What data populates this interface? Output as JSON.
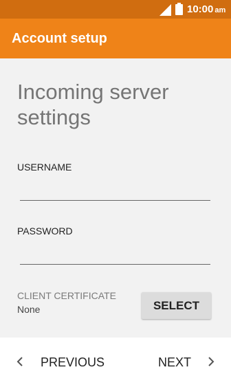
{
  "status_bar": {
    "time": "10:00",
    "period": "am",
    "icons": [
      "signal-icon",
      "battery-icon"
    ],
    "background": "#d06d10"
  },
  "app_bar": {
    "title": "Account setup",
    "background": "#ef8318"
  },
  "main": {
    "heading": "Incoming server settings",
    "username": {
      "label": "USERNAME",
      "value": ""
    },
    "password": {
      "label": "PASSWORD",
      "value": ""
    },
    "client_certificate": {
      "label": "CLIENT CERTIFICATE",
      "value": "None",
      "button_label": "SELECT"
    }
  },
  "navigation": {
    "previous_label": "PREVIOUS",
    "previous_icon": "chevron-left-icon",
    "next_label": "NEXT",
    "next_icon": "chevron-right-icon"
  }
}
